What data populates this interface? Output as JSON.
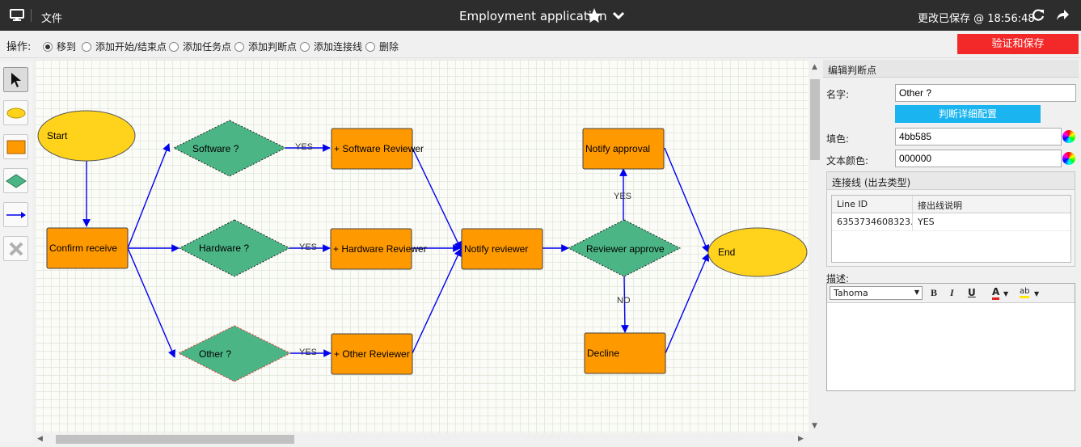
{
  "titlebar": {
    "file_menu": "文件",
    "title": "Employment application",
    "saved_status": "更改已保存 @ 18:56:48"
  },
  "toolbar": {
    "op_label": "操作:",
    "modes": [
      {
        "label": "移到",
        "selected": true
      },
      {
        "label": "添加开始/结束点",
        "selected": false
      },
      {
        "label": "添加任务点",
        "selected": false
      },
      {
        "label": "添加判断点",
        "selected": false
      },
      {
        "label": "添加连接线",
        "selected": false
      },
      {
        "label": "删除",
        "selected": false
      }
    ],
    "save_button": "验证和保存"
  },
  "palette": [
    "pointer-tool",
    "ellipse-tool",
    "rectangle-tool",
    "diamond-tool",
    "connector-tool",
    "delete-tool"
  ],
  "diagram": {
    "nodes": {
      "start": "Start",
      "confirm": "Confirm receive",
      "software_q": "Software ?",
      "hardware_q": "Hardware ?",
      "other_q": "Other ?",
      "software_rev": "+ Software Reviewer",
      "hardware_rev": "+ Hardware Reviewer",
      "other_rev": "+ Other Reviewer",
      "notify_reviewer": "Notify reviewer",
      "reviewer_approve": "Reviewer approve",
      "notify_approval": "Notify approval",
      "decline": "Decline",
      "end": "End"
    },
    "edge_labels": {
      "software_yes": "YES",
      "hardware_yes": "YES",
      "other_yes": "YES",
      "approve_yes": "YES",
      "approve_no": "NO"
    },
    "colors": {
      "terminal": "#ffd21c",
      "task": "#ff9900",
      "decision": "#4bb585",
      "edge": "#0000ee"
    }
  },
  "panel": {
    "header": "编辑判断点",
    "name_label": "名字:",
    "name_value": "Other ?",
    "config_button": "判断详细配置",
    "fill_label": "填色:",
    "fill_value": "4bb585",
    "text_color_label": "文本颜色:",
    "text_color_value": "000000",
    "lines_header": "连接线 (出去类型)",
    "grid_headers": [
      "Line ID",
      "接出线说明"
    ],
    "grid_rows": [
      [
        "6353734608323...",
        "YES"
      ]
    ],
    "desc_label": "描述:",
    "font_name": "Tahoma"
  }
}
